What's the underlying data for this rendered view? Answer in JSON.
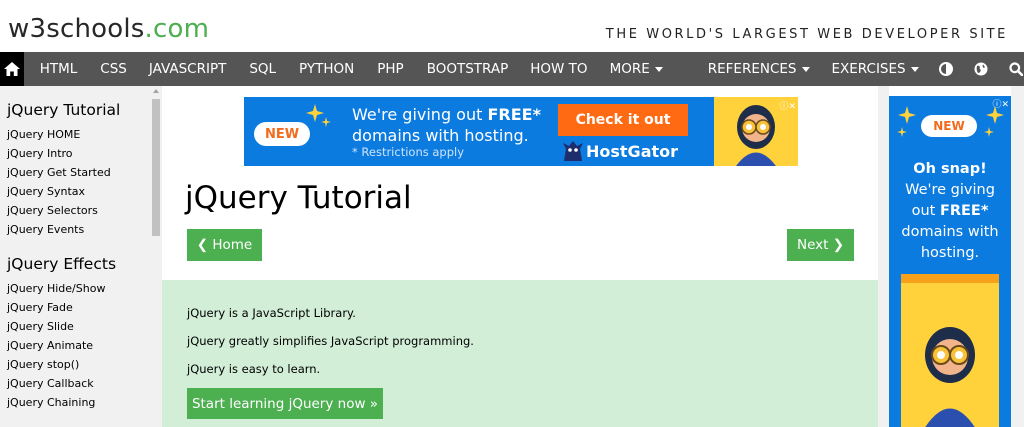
{
  "header": {
    "logo_w3": "w3schools",
    "logo_com": ".com",
    "tagline": "THE WORLD'S LARGEST WEB DEVELOPER SITE"
  },
  "nav": {
    "items": [
      "HTML",
      "CSS",
      "JAVASCRIPT",
      "SQL",
      "PYTHON",
      "PHP",
      "BOOTSTRAP",
      "HOW TO",
      "MORE",
      "REFERENCES",
      "EXERCISES"
    ],
    "icons": [
      "home-icon",
      "contrast-icon",
      "globe-icon",
      "search-icon"
    ]
  },
  "sidebar": {
    "heading1": "jQuery Tutorial",
    "links1": [
      "jQuery HOME",
      "jQuery Intro",
      "jQuery Get Started",
      "jQuery Syntax",
      "jQuery Selectors",
      "jQuery Events"
    ],
    "heading2": "jQuery Effects",
    "links2": [
      "jQuery Hide/Show",
      "jQuery Fade",
      "jQuery Slide",
      "jQuery Animate",
      "jQuery stop()",
      "jQuery Callback",
      "jQuery Chaining"
    ]
  },
  "ad_top": {
    "badge": "NEW",
    "line1_a": "We're giving out ",
    "line1_b": "FREE*",
    "line2": "domains with hosting.",
    "restrict": "* Restrictions apply",
    "cta": "Check it out",
    "brand": "HostGator"
  },
  "main": {
    "title": "jQuery Tutorial",
    "prev": "❮ Home",
    "next": "Next ❯",
    "intro": [
      "jQuery is a JavaScript Library.",
      "jQuery greatly simplifies JavaScript programming.",
      "jQuery is easy to learn."
    ],
    "start": "Start learning jQuery now »"
  },
  "ad_right": {
    "badge": "NEW",
    "l1": "Oh snap!",
    "l2": "We're giving",
    "l3a": "out ",
    "l3b": "FREE*",
    "l4": "domains with",
    "l5": "hosting."
  },
  "colors": {
    "brand_green": "#4CAF50",
    "nav_bg": "#555555",
    "intro_bg": "#d2eed7",
    "ad_blue": "#0b7be0",
    "ad_orange": "#ff6a13"
  }
}
